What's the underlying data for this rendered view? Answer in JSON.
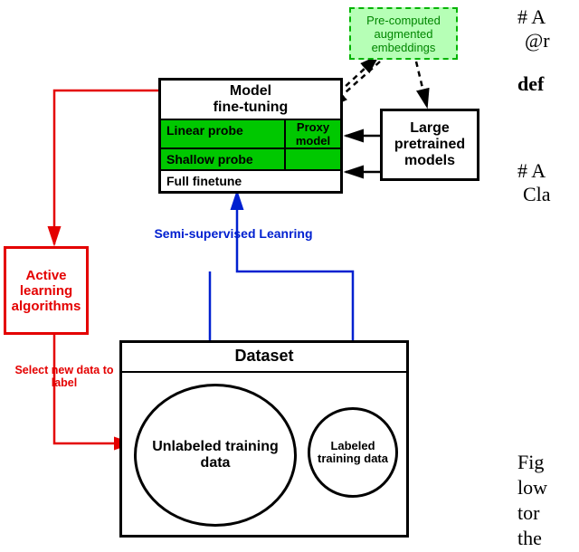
{
  "precomp": "Pre-computed augmented embeddings",
  "model_ft": {
    "title_l1": "Model",
    "title_l2": "fine-tuning",
    "linear": "Linear probe",
    "shallow": "Shallow probe",
    "proxy_l1": "Proxy",
    "proxy_l2": "model",
    "full": "Full finetune"
  },
  "large_pm": "Large pretrained models",
  "active_learning": "Active learning algorithms",
  "dataset": {
    "title": "Dataset",
    "unlabeled": "Unlabeled training data",
    "labeled": "Labeled training data"
  },
  "edges": {
    "ssl": "Semi-supervised Leanring",
    "select": "Select new data to label"
  },
  "right_fragments": {
    "hash1": "# A",
    "at": "@r",
    "def": "def",
    "hash2": "# A",
    "cla": "Cla",
    "fig": "Fig",
    "low": "low",
    "tor": "tor",
    "the": "the"
  }
}
